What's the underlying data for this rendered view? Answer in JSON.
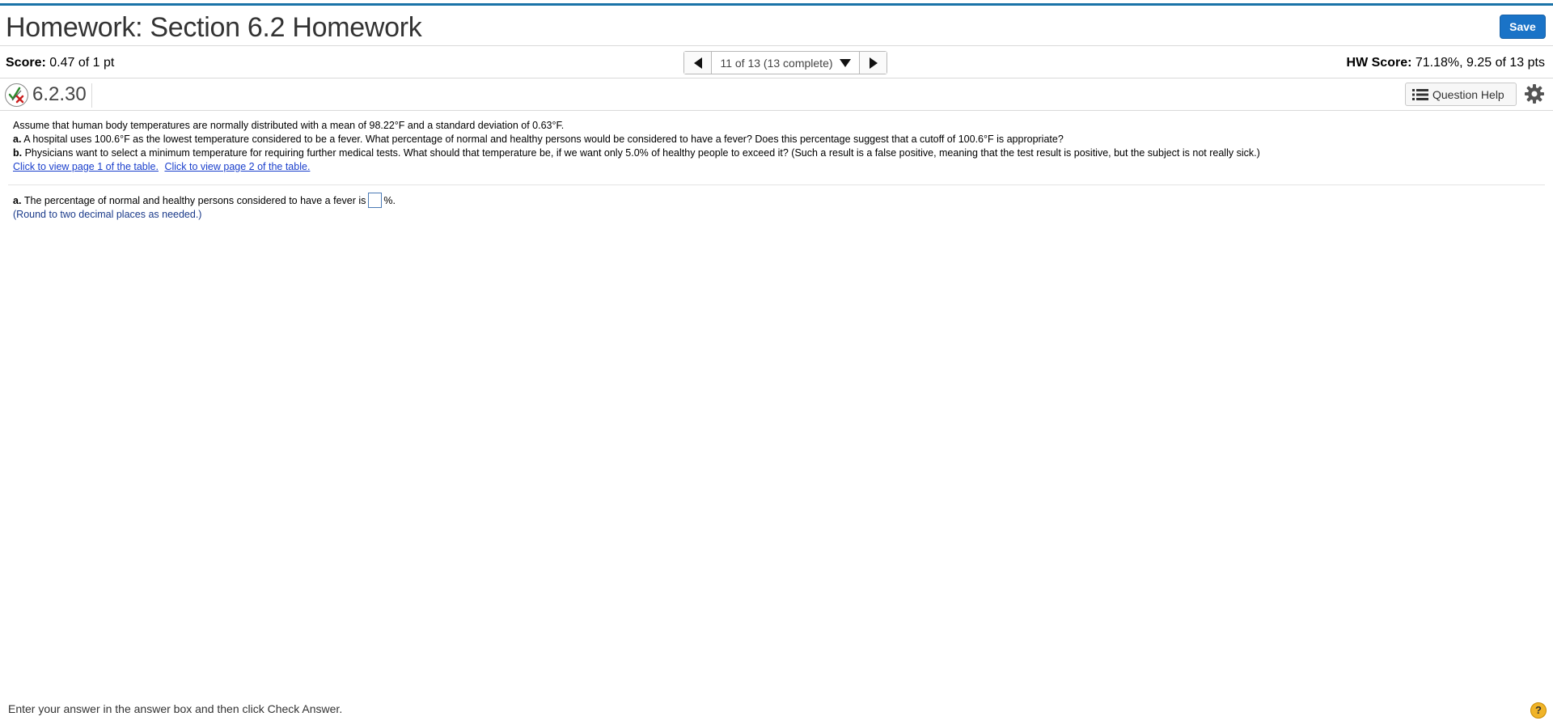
{
  "header": {
    "title": "Homework: Section 6.2 Homework",
    "save_label": "Save"
  },
  "score_bar": {
    "score_label": "Score:",
    "score_value": "0.47 of 1 pt",
    "nav_label": "11 of 13 (13 complete)",
    "hw_score_label": "HW Score:",
    "hw_score_value": "71.18%, 9.25 of 13 pts"
  },
  "question": {
    "number": "6.2.30",
    "help_label": "Question Help",
    "intro": "Assume that human body temperatures are normally distributed with a mean of 98.22°F and a standard deviation of 0.63°F.",
    "part_a_label": "a.",
    "part_a_text": "A hospital uses 100.6°F as the lowest temperature considered to be a fever. What percentage of normal and healthy persons would be considered to have a fever? Does this percentage suggest that a cutoff of 100.6°F is appropriate?",
    "part_b_label": "b.",
    "part_b_text": "Physicians want to select a minimum temperature for requiring further medical tests. What should that temperature be, if we want only 5.0% of healthy people to exceed it? (Such a result is a false positive, meaning that the test result is positive, but the subject is not really sick.)",
    "link_page1": "Click to view page 1 of the table.",
    "link_page2": "Click to view page 2 of the table."
  },
  "answer": {
    "label": "a.",
    "prompt": "The percentage of normal and healthy persons considered to have a fever is",
    "suffix": "%.",
    "value": "",
    "note": "(Round to two decimal places as needed.)"
  },
  "footer": {
    "instruction": "Enter your answer in the answer box and then click Check Answer.",
    "help_glyph": "?"
  },
  "colors": {
    "accent": "#1a73c7",
    "link": "#1a3fcc",
    "note": "#1a3a8a"
  }
}
